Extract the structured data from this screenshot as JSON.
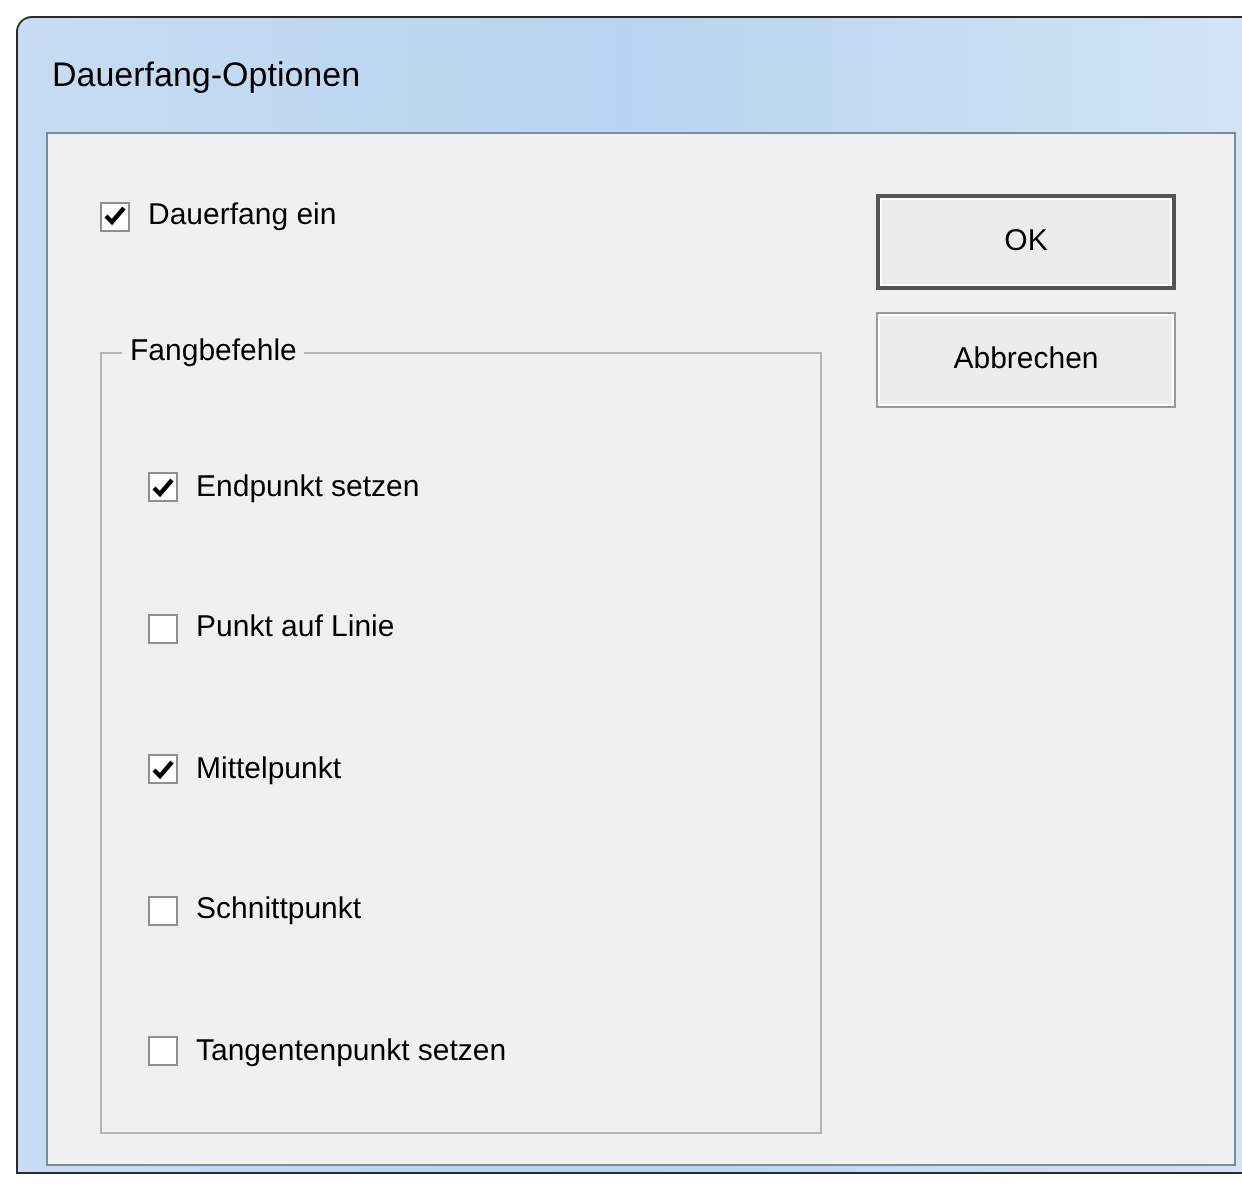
{
  "window": {
    "title": "Dauerfang-Optionen"
  },
  "main_option": {
    "label": "Dauerfang ein",
    "checked": true
  },
  "group": {
    "title": "Fangbefehle",
    "items": [
      {
        "label": "Endpunkt setzen",
        "checked": true
      },
      {
        "label": "Punkt auf Linie",
        "checked": false
      },
      {
        "label": "Mittelpunkt",
        "checked": true
      },
      {
        "label": "Schnittpunkt",
        "checked": false
      },
      {
        "label": "Tangentenpunkt setzen",
        "checked": false
      }
    ]
  },
  "buttons": [
    "OK",
    "Abbrechen"
  ]
}
